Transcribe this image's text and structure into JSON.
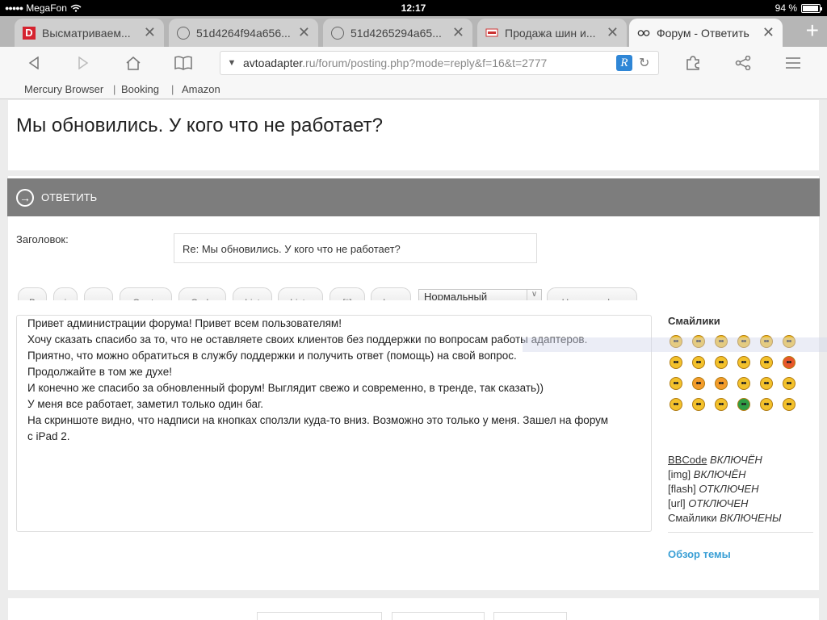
{
  "status_bar": {
    "carrier": "MegaFon",
    "time": "12:17",
    "battery": "94 %",
    "battery_level": 0.94
  },
  "tabs": [
    {
      "title": "Высматриваем...",
      "icon": "d-logo-icon",
      "active": false
    },
    {
      "title": "51d4264f94a656...",
      "icon": "globe-icon",
      "active": false
    },
    {
      "title": "51d4265294a65...",
      "icon": "globe-icon",
      "active": false
    },
    {
      "title": "Продажа шин и...",
      "icon": "site-logo-icon",
      "active": false
    },
    {
      "title": "Форум - Ответить",
      "icon": "goggles-icon",
      "active": true
    }
  ],
  "address_bar": {
    "domain": "avtoadapter",
    "rest": ".ru/forum/posting.php?mode=reply&f=16&t=2777"
  },
  "bookmarks": [
    "Mercury Browser",
    "Booking",
    "Amazon"
  ],
  "page": {
    "topic_title": "Мы обновились. У кого что не работает?",
    "reply_heading": "ОТВЕТИТЬ",
    "subject_label": "Заголовок:",
    "subject_value": "Re: Мы обновились. У кого что не работает?",
    "format_buttons": [
      "B",
      "i",
      "u",
      "Quote",
      "Code",
      "List",
      "List=",
      "[*]",
      "Img"
    ],
    "font_size_select": "Нормальный",
    "font_color_button": "Цвет шрифта",
    "message_lines": [
      "Привет администрации форума! Привет всем пользователям!",
      "Хочу сказать спасибо за то, что не оставляете своих клиентов без поддержки по вопросам работы адаптеров.",
      "Приятно, что можно обратиться в службу поддержки и получить ответ (помощь) на свой вопрос.",
      "Продолжайте в том же духе!",
      "И конечно же спасибо за обновленный форум! Выглядит свежо и современно, в тренде, так сказать))",
      "У меня все работает, заметил только один баг.",
      "На скриншоте видно, что надписи на кнопках сползли куда-то вниз. Возможно это только у меня. Зашел на форум",
      "с iPad 2."
    ],
    "smilies_title": "Смайлики",
    "smilies": [
      {
        "name": "grin-smiley-icon",
        "color": "#f3c12b"
      },
      {
        "name": "laugh-smiley-icon",
        "color": "#f3c12b"
      },
      {
        "name": "wink-smiley-icon",
        "color": "#f3c12b"
      },
      {
        "name": "cool-smiley-icon",
        "color": "#f3c12b"
      },
      {
        "name": "shocked-smiley-icon",
        "color": "#f3c12b"
      },
      {
        "name": "eek-smiley-icon",
        "color": "#f3c12b"
      },
      {
        "name": "confused-smiley-icon",
        "color": "#f3c12b"
      },
      {
        "name": "sunglasses-smiley-icon",
        "color": "#f3c12b"
      },
      {
        "name": "tongue-smiley-icon",
        "color": "#f3c12b"
      },
      {
        "name": "mad-smiley-icon",
        "color": "#f3c12b"
      },
      {
        "name": "razz-smiley-icon",
        "color": "#f3c12b"
      },
      {
        "name": "angry-smiley-icon",
        "color": "#e8572a"
      },
      {
        "name": "neutral-smiley-icon",
        "color": "#f3c12b"
      },
      {
        "name": "evil-smiley-icon",
        "color": "#f39c2b"
      },
      {
        "name": "twisted-smiley-icon",
        "color": "#f39c2b"
      },
      {
        "name": "rolleyes-smiley-icon",
        "color": "#f3c12b"
      },
      {
        "name": "exclaim-smiley-icon",
        "color": "#f3c12b"
      },
      {
        "name": "question-smiley-icon",
        "color": "#f3c12b"
      },
      {
        "name": "idea-smiley-icon",
        "color": "#f3c12b"
      },
      {
        "name": "arrow-smiley-icon",
        "color": "#f3c12b"
      },
      {
        "name": "sad-smiley-icon",
        "color": "#f3c12b"
      },
      {
        "name": "green-smiley-icon",
        "color": "#2f9e44"
      },
      {
        "name": "geek-smiley-icon",
        "color": "#f3c12b"
      },
      {
        "name": "nerd-smiley-icon",
        "color": "#f3c12b"
      }
    ],
    "status": [
      {
        "key": "BBCode",
        "value": "ВКЛЮЧЁН",
        "link": true
      },
      {
        "key": "[img]",
        "value": "ВКЛЮЧЁН",
        "link": false
      },
      {
        "key": "[flash]",
        "value": "ОТКЛЮЧЕН",
        "link": false
      },
      {
        "key": "[url]",
        "value": "ОТКЛЮЧЕН",
        "link": false
      },
      {
        "key": "Смайлики",
        "value": "ВКЛЮЧЕНЫ",
        "link": false
      }
    ],
    "topic_review_link": "Обзор темы"
  },
  "colors": {
    "reply_bar": "#7d7d7d",
    "link": "#3a9fd5",
    "tab_strip": "#b6b6b6"
  }
}
